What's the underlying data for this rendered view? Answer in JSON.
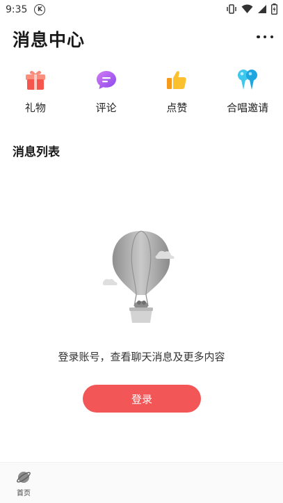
{
  "status_bar": {
    "time": "9:35",
    "k_badge": "K",
    "icons": [
      "vibrate-icon",
      "wifi-icon",
      "signal-icon",
      "battery-icon"
    ]
  },
  "header": {
    "title": "消息中心",
    "more_icon": "more-dots-icon"
  },
  "quick_actions": [
    {
      "label": "礼物",
      "icon": "gift-icon"
    },
    {
      "label": "评论",
      "icon": "comment-icon"
    },
    {
      "label": "点赞",
      "icon": "thumbs-up-icon"
    },
    {
      "label": "合唱邀请",
      "icon": "chorus-microphone-icon"
    }
  ],
  "messages": {
    "section_title": "消息列表",
    "empty_illustration": "hot-air-balloon-illustration",
    "empty_text": "登录账号，查看聊天消息及更多内容",
    "login_label": "登录"
  },
  "bottom_nav": {
    "items": [
      {
        "label": "首页",
        "icon": "planet-icon"
      }
    ]
  },
  "colors": {
    "accent": "#f25656",
    "gift": "#f5574f",
    "comment": "#b05ef0",
    "thumbs_up": "#f7b52c",
    "chorus": "#27c3e8"
  }
}
